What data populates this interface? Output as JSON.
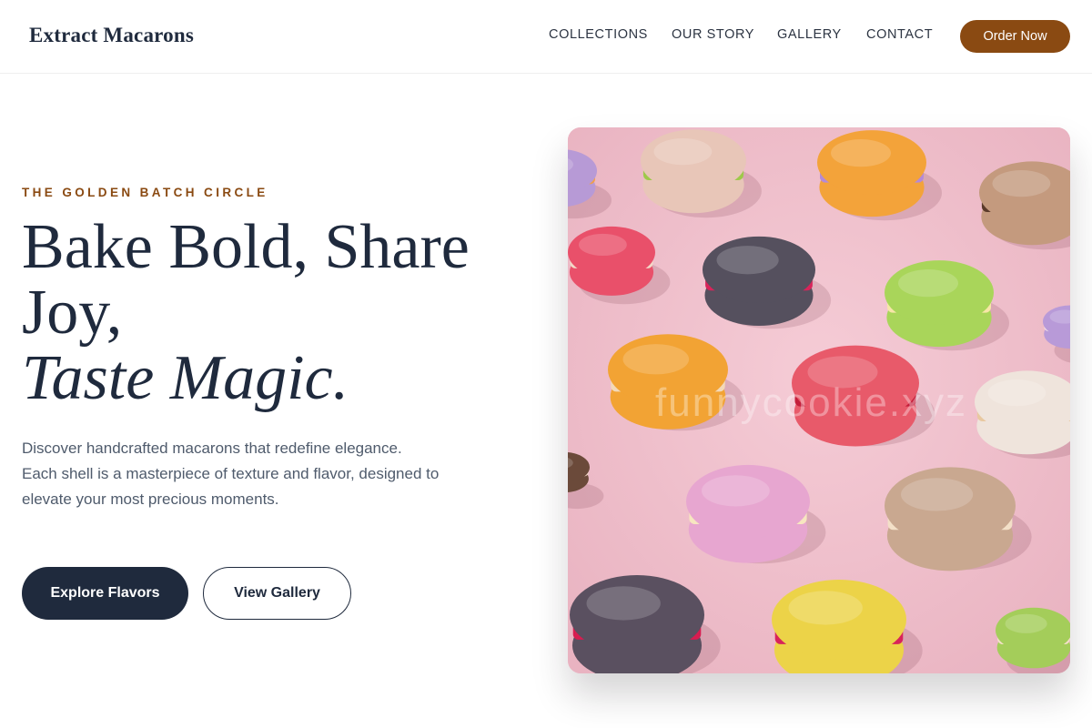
{
  "brand": {
    "name": "Extract Macarons"
  },
  "nav": {
    "links": [
      "COLLECTIONS",
      "OUR STORY",
      "GALLERY",
      "CONTACT"
    ],
    "cta": "Order Now"
  },
  "hero": {
    "eyebrow": "THE GOLDEN BATCH CIRCLE",
    "headline_line1": "Bake Bold, Share",
    "headline_line2": "Joy,",
    "headline_line3": "Taste Magic.",
    "description": "Discover handcrafted macarons that redefine elegance. Each shell is a masterpiece of texture and flavor, designed to elevate your most precious moments.",
    "primary_button": "Explore Flavors",
    "secondary_button": "View Gallery",
    "watermark": "funnycookie.xyz"
  },
  "colors": {
    "accent": "#8a4a12",
    "navy": "#1f2a3d",
    "body_text": "#4f5b6c",
    "image_background": "#f0c3cf"
  }
}
